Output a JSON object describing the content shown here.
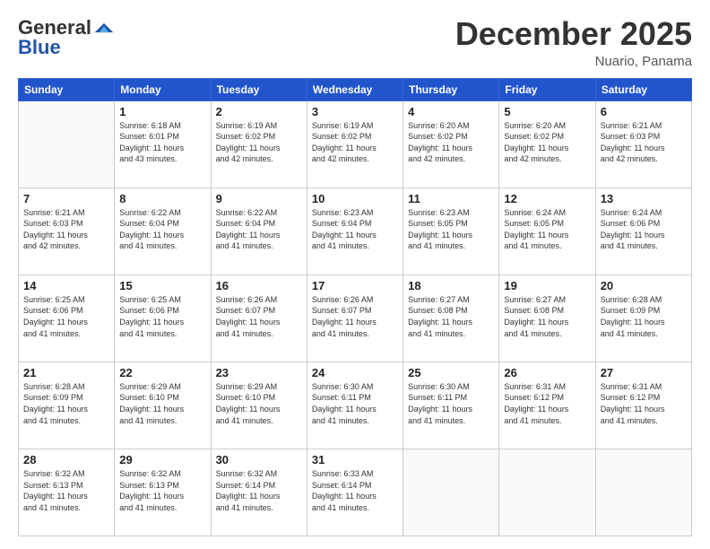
{
  "header": {
    "logo_general": "General",
    "logo_blue": "Blue",
    "month_title": "December 2025",
    "location": "Nuario, Panama"
  },
  "weekdays": [
    "Sunday",
    "Monday",
    "Tuesday",
    "Wednesday",
    "Thursday",
    "Friday",
    "Saturday"
  ],
  "weeks": [
    [
      {
        "day": "",
        "info": ""
      },
      {
        "day": "1",
        "info": "Sunrise: 6:18 AM\nSunset: 6:01 PM\nDaylight: 11 hours\nand 43 minutes."
      },
      {
        "day": "2",
        "info": "Sunrise: 6:19 AM\nSunset: 6:02 PM\nDaylight: 11 hours\nand 42 minutes."
      },
      {
        "day": "3",
        "info": "Sunrise: 6:19 AM\nSunset: 6:02 PM\nDaylight: 11 hours\nand 42 minutes."
      },
      {
        "day": "4",
        "info": "Sunrise: 6:20 AM\nSunset: 6:02 PM\nDaylight: 11 hours\nand 42 minutes."
      },
      {
        "day": "5",
        "info": "Sunrise: 6:20 AM\nSunset: 6:02 PM\nDaylight: 11 hours\nand 42 minutes."
      },
      {
        "day": "6",
        "info": "Sunrise: 6:21 AM\nSunset: 6:03 PM\nDaylight: 11 hours\nand 42 minutes."
      }
    ],
    [
      {
        "day": "7",
        "info": "Sunrise: 6:21 AM\nSunset: 6:03 PM\nDaylight: 11 hours\nand 42 minutes."
      },
      {
        "day": "8",
        "info": "Sunrise: 6:22 AM\nSunset: 6:04 PM\nDaylight: 11 hours\nand 41 minutes."
      },
      {
        "day": "9",
        "info": "Sunrise: 6:22 AM\nSunset: 6:04 PM\nDaylight: 11 hours\nand 41 minutes."
      },
      {
        "day": "10",
        "info": "Sunrise: 6:23 AM\nSunset: 6:04 PM\nDaylight: 11 hours\nand 41 minutes."
      },
      {
        "day": "11",
        "info": "Sunrise: 6:23 AM\nSunset: 6:05 PM\nDaylight: 11 hours\nand 41 minutes."
      },
      {
        "day": "12",
        "info": "Sunrise: 6:24 AM\nSunset: 6:05 PM\nDaylight: 11 hours\nand 41 minutes."
      },
      {
        "day": "13",
        "info": "Sunrise: 6:24 AM\nSunset: 6:06 PM\nDaylight: 11 hours\nand 41 minutes."
      }
    ],
    [
      {
        "day": "14",
        "info": "Sunrise: 6:25 AM\nSunset: 6:06 PM\nDaylight: 11 hours\nand 41 minutes."
      },
      {
        "day": "15",
        "info": "Sunrise: 6:25 AM\nSunset: 6:06 PM\nDaylight: 11 hours\nand 41 minutes."
      },
      {
        "day": "16",
        "info": "Sunrise: 6:26 AM\nSunset: 6:07 PM\nDaylight: 11 hours\nand 41 minutes."
      },
      {
        "day": "17",
        "info": "Sunrise: 6:26 AM\nSunset: 6:07 PM\nDaylight: 11 hours\nand 41 minutes."
      },
      {
        "day": "18",
        "info": "Sunrise: 6:27 AM\nSunset: 6:08 PM\nDaylight: 11 hours\nand 41 minutes."
      },
      {
        "day": "19",
        "info": "Sunrise: 6:27 AM\nSunset: 6:08 PM\nDaylight: 11 hours\nand 41 minutes."
      },
      {
        "day": "20",
        "info": "Sunrise: 6:28 AM\nSunset: 6:09 PM\nDaylight: 11 hours\nand 41 minutes."
      }
    ],
    [
      {
        "day": "21",
        "info": "Sunrise: 6:28 AM\nSunset: 6:09 PM\nDaylight: 11 hours\nand 41 minutes."
      },
      {
        "day": "22",
        "info": "Sunrise: 6:29 AM\nSunset: 6:10 PM\nDaylight: 11 hours\nand 41 minutes."
      },
      {
        "day": "23",
        "info": "Sunrise: 6:29 AM\nSunset: 6:10 PM\nDaylight: 11 hours\nand 41 minutes."
      },
      {
        "day": "24",
        "info": "Sunrise: 6:30 AM\nSunset: 6:11 PM\nDaylight: 11 hours\nand 41 minutes."
      },
      {
        "day": "25",
        "info": "Sunrise: 6:30 AM\nSunset: 6:11 PM\nDaylight: 11 hours\nand 41 minutes."
      },
      {
        "day": "26",
        "info": "Sunrise: 6:31 AM\nSunset: 6:12 PM\nDaylight: 11 hours\nand 41 minutes."
      },
      {
        "day": "27",
        "info": "Sunrise: 6:31 AM\nSunset: 6:12 PM\nDaylight: 11 hours\nand 41 minutes."
      }
    ],
    [
      {
        "day": "28",
        "info": "Sunrise: 6:32 AM\nSunset: 6:13 PM\nDaylight: 11 hours\nand 41 minutes."
      },
      {
        "day": "29",
        "info": "Sunrise: 6:32 AM\nSunset: 6:13 PM\nDaylight: 11 hours\nand 41 minutes."
      },
      {
        "day": "30",
        "info": "Sunrise: 6:32 AM\nSunset: 6:14 PM\nDaylight: 11 hours\nand 41 minutes."
      },
      {
        "day": "31",
        "info": "Sunrise: 6:33 AM\nSunset: 6:14 PM\nDaylight: 11 hours\nand 41 minutes."
      },
      {
        "day": "",
        "info": ""
      },
      {
        "day": "",
        "info": ""
      },
      {
        "day": "",
        "info": ""
      }
    ]
  ]
}
